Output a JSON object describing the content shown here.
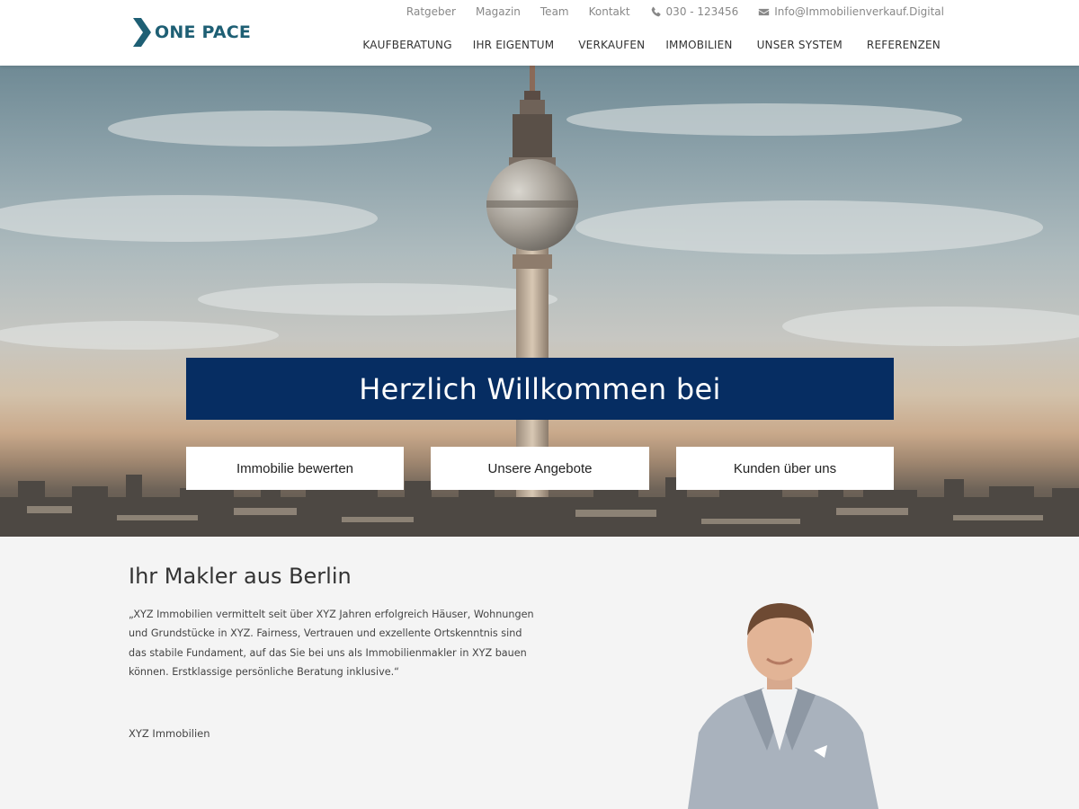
{
  "brand": {
    "name": "ONE PACE",
    "color": "#1e5f74"
  },
  "topbar": {
    "links": [
      "Ratgeber",
      "Magazin",
      "Team",
      "Kontakt"
    ],
    "phone": "030 - 123456",
    "email": "Info@Immobilienverkauf.Digital"
  },
  "nav": {
    "items": [
      "KAUFBERATUNG",
      "IHR EIGENTUM",
      "VERKAUFEN",
      "IMMOBILIEN",
      "UNSER SYSTEM",
      "REFERENZEN"
    ]
  },
  "hero": {
    "title": "Herzlich Willkommen bei",
    "title_bg": "#062d62",
    "buttons": [
      "Immobilie bewerten",
      "Unsere Angebote",
      "Kunden über uns"
    ]
  },
  "about": {
    "heading": "Ihr Makler aus Berlin",
    "quote": "„XYZ Immobilien vermittelt seit über XYZ Jahren erfolgreich Häuser, Wohnungen und Grundstücke in XYZ. Fairness, Vertrauen und exzellente Ortskenntnis sind das stabile Fundament, auf das Sie bei uns als Immobilienmakler in XYZ bauen können. Erstklassige persönliche Beratung inklusive.“",
    "signature": "XYZ Immobilien"
  }
}
